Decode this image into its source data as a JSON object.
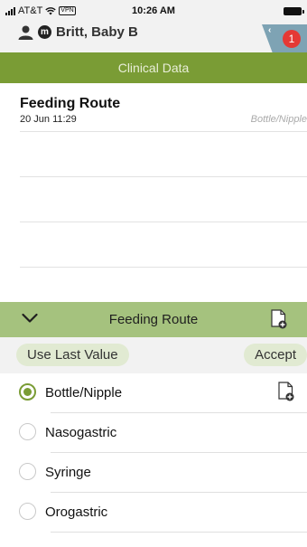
{
  "status_bar": {
    "carrier": "AT&T",
    "vpn": "VPN",
    "time": "10:26 AM"
  },
  "patient": {
    "initial": "m",
    "name": "Britt, Baby B",
    "alert_count": "1"
  },
  "section_title": "Clinical Data",
  "record": {
    "title": "Feeding Route",
    "datetime": "20 Jun 11:29",
    "value": "Bottle/Nipple"
  },
  "editor": {
    "title": "Feeding Route",
    "use_last_value": "Use Last Value",
    "accept": "Accept",
    "options": [
      {
        "label": "Bottle/Nipple",
        "selected": true
      },
      {
        "label": "Nasogastric",
        "selected": false
      },
      {
        "label": "Syringe",
        "selected": false
      },
      {
        "label": "Orogastric",
        "selected": false
      }
    ]
  },
  "colors": {
    "brand_green": "#7a9c35",
    "light_green": "#a5c27e",
    "pill_bg": "#e1ead2",
    "alert_red": "#e53935"
  },
  "icons": {
    "signal": "signal-icon",
    "wifi": "wifi-icon",
    "battery": "battery-icon",
    "person": "person-icon",
    "collapse": "chevron-down-icon",
    "add_note": "document-add-icon"
  }
}
